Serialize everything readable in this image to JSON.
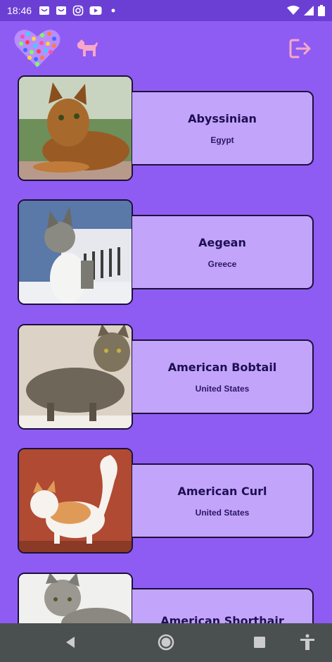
{
  "status_bar": {
    "time": "18:46",
    "icons": [
      "shopping-bag-icon",
      "shopping-bag-icon",
      "instagram-icon",
      "youtube-icon",
      "dot-icon"
    ],
    "right_icons": [
      "wifi-icon",
      "signal-icon",
      "battery-icon"
    ]
  },
  "header": {
    "logo_icon": "paw-heart-logo",
    "dog_icon": "dog-icon",
    "logout_icon": "logout-icon"
  },
  "breeds": [
    {
      "name": "Abyssinian",
      "origin": "Egypt"
    },
    {
      "name": "Aegean",
      "origin": "Greece"
    },
    {
      "name": "American Bobtail",
      "origin": "United States"
    },
    {
      "name": "American Curl",
      "origin": "United States"
    },
    {
      "name": "American Shorthair",
      "origin": ""
    }
  ],
  "navbar": {
    "icons": [
      "back-icon",
      "home-icon",
      "recents-icon",
      "accessibility-icon"
    ]
  },
  "colors": {
    "background": "#8e5cf3",
    "card": "#c3a4fb",
    "accent_pink": "#f7a8c8"
  }
}
